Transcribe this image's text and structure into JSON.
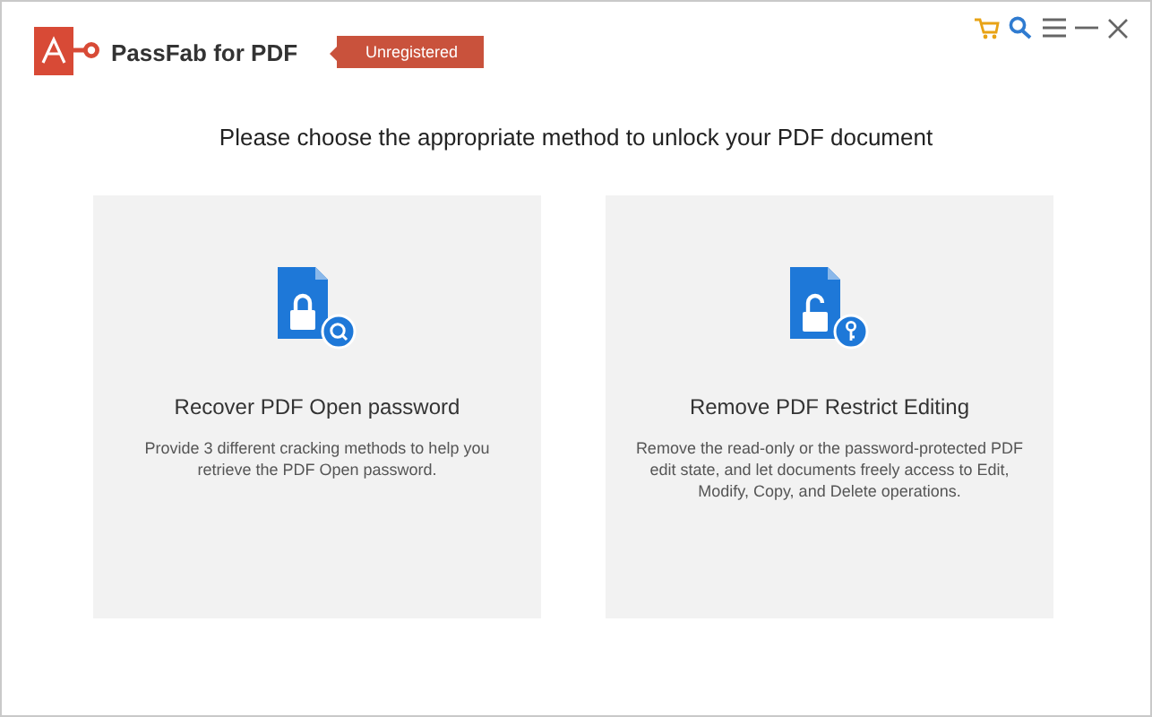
{
  "app": {
    "title": "PassFab for PDF",
    "badge": "Unregistered"
  },
  "heading": "Please choose the appropriate method to unlock your PDF document",
  "options": [
    {
      "kind": "recover",
      "title": "Recover PDF Open password",
      "description": "Provide 3 different cracking methods to help you retrieve the PDF Open password."
    },
    {
      "kind": "remove",
      "title": "Remove PDF Restrict Editing",
      "description": "Remove the read-only or the password-protected PDF edit state, and let documents freely access to Edit, Modify, Copy, and Delete operations."
    }
  ]
}
